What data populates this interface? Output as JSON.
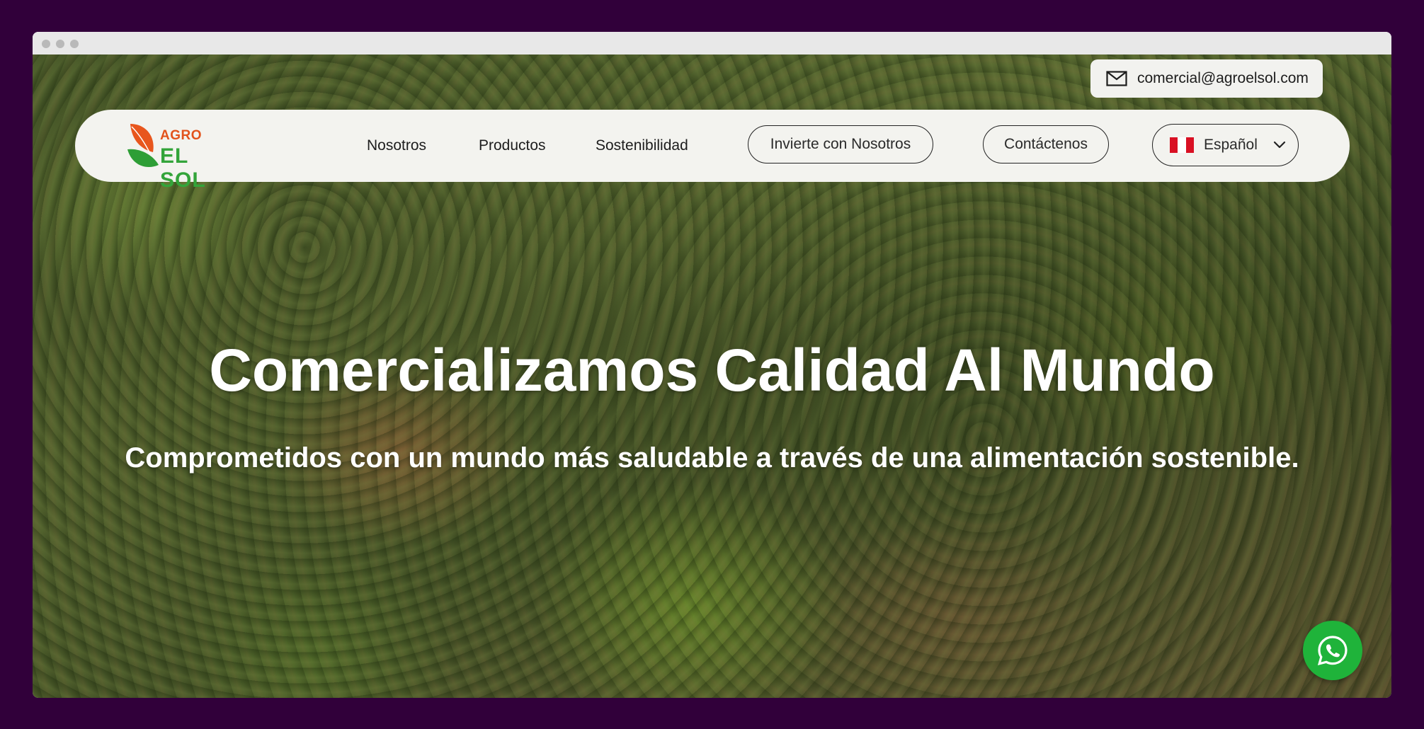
{
  "contact": {
    "email": "comercial@agroelsol.com",
    "email_icon": "mail-icon"
  },
  "logo": {
    "line1": "AGRO",
    "line2": "EL SOL",
    "colors": {
      "agro": "#e2531c",
      "elsol": "#33a43a"
    }
  },
  "nav": {
    "items": [
      {
        "label": "Nosotros"
      },
      {
        "label": "Productos"
      },
      {
        "label": "Sostenibilidad"
      }
    ],
    "invest_label": "Invierte con Nosotros",
    "contact_label": "Contáctenos"
  },
  "language": {
    "selected": "Español",
    "flag_icon": "peru-flag-icon",
    "dropdown_icon": "chevron-down-icon"
  },
  "hero": {
    "title": "Comercializamos Calidad Al Mundo",
    "subtitle": "Comprometidos con un mundo más saludable a través de una alimentación sostenible."
  },
  "floating": {
    "whatsapp_icon": "whatsapp-icon",
    "color": "#1fb33a"
  },
  "theme": {
    "page_background": "#31003a",
    "navbar_background": "#f3f3ef"
  }
}
